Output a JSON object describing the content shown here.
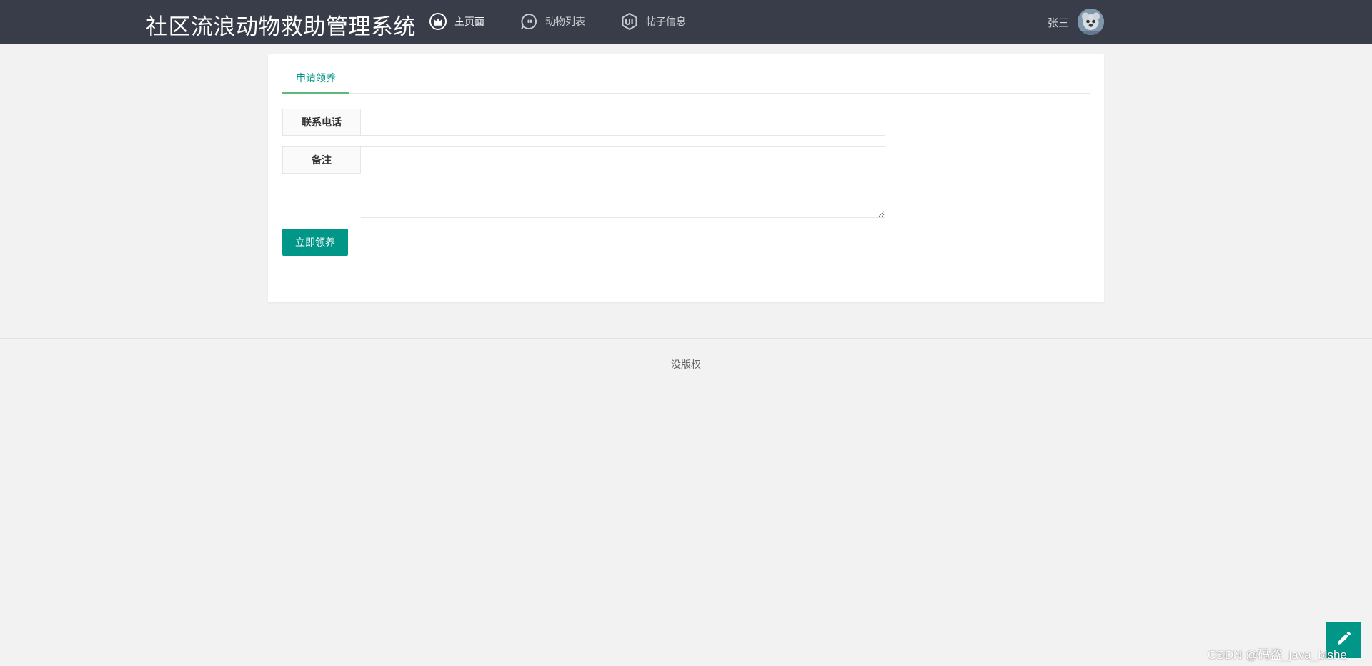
{
  "header": {
    "title": "社区流浪动物救助管理系统",
    "nav": [
      {
        "label": "主页面",
        "icon": "crown-icon",
        "active": true
      },
      {
        "label": "动物列表",
        "icon": "chat-bubble-icon",
        "active": false
      },
      {
        "label": "帖子信息",
        "icon": "ui-shield-icon",
        "active": false
      }
    ],
    "user_name": "张三"
  },
  "tabs": [
    {
      "label": "申请领养",
      "active": true
    }
  ],
  "form": {
    "phone_label": "联系电话",
    "phone_value": "",
    "note_label": "备注",
    "note_value": "",
    "submit_label": "立即领养"
  },
  "footer": {
    "text": "没版权"
  },
  "watermark": "CSDN @码盗_java_bishe",
  "colors": {
    "header_bg": "#393d49",
    "accent": "#009688",
    "tab_underline": "#5fb878",
    "page_bg": "#f2f2f2"
  }
}
